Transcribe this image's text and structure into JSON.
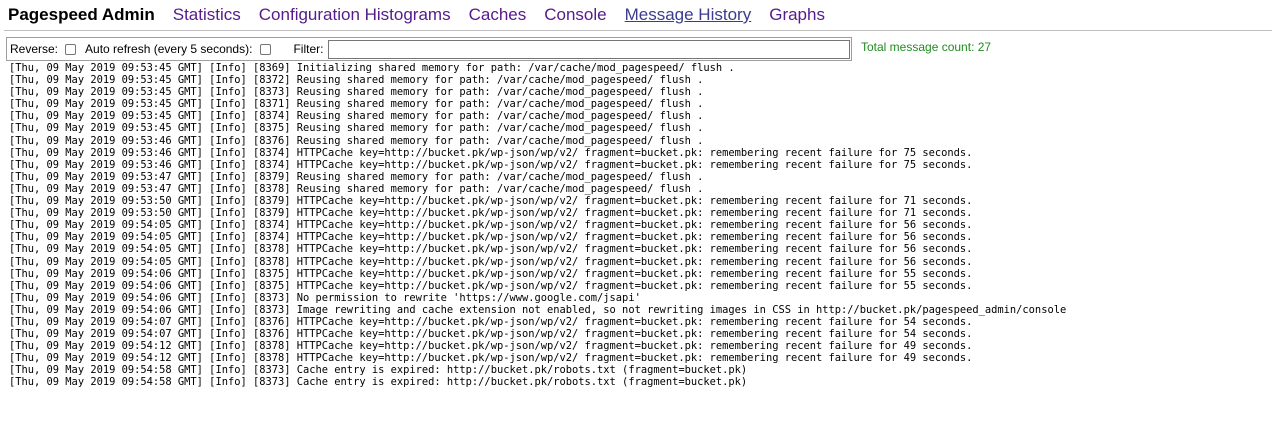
{
  "nav": {
    "brand": "Pagespeed Admin",
    "links": [
      {
        "label": "Statistics"
      },
      {
        "label": "Configuration Histograms"
      },
      {
        "label": "Caches"
      },
      {
        "label": "Console"
      },
      {
        "label": "Message History",
        "active": true
      },
      {
        "label": "Graphs"
      }
    ]
  },
  "controls": {
    "reverse_label": "Reverse:",
    "reverse_checked": false,
    "auto_refresh_label": "Auto refresh (every 5 seconds):",
    "auto_refresh_checked": false,
    "filter_label": "Filter:",
    "filter_value": "",
    "filter_placeholder": ""
  },
  "status": {
    "total_count_text": "Total message count: 27",
    "total_count_color": "#228b22"
  },
  "colors": {
    "link": "#551a8b",
    "active_link": "#3b3b8f"
  },
  "messages": [
    "[Thu, 09 May 2019 09:53:45 GMT] [Info] [8369] Initializing shared memory for path: /var/cache/mod_pagespeed/ flush .",
    "[Thu, 09 May 2019 09:53:45 GMT] [Info] [8372] Reusing shared memory for path: /var/cache/mod_pagespeed/ flush .",
    "[Thu, 09 May 2019 09:53:45 GMT] [Info] [8373] Reusing shared memory for path: /var/cache/mod_pagespeed/ flush .",
    "[Thu, 09 May 2019 09:53:45 GMT] [Info] [8371] Reusing shared memory for path: /var/cache/mod_pagespeed/ flush .",
    "[Thu, 09 May 2019 09:53:45 GMT] [Info] [8374] Reusing shared memory for path: /var/cache/mod_pagespeed/ flush .",
    "[Thu, 09 May 2019 09:53:45 GMT] [Info] [8375] Reusing shared memory for path: /var/cache/mod_pagespeed/ flush .",
    "[Thu, 09 May 2019 09:53:46 GMT] [Info] [8376] Reusing shared memory for path: /var/cache/mod_pagespeed/ flush .",
    "[Thu, 09 May 2019 09:53:46 GMT] [Info] [8374] HTTPCache key=http://bucket.pk/wp-json/wp/v2/ fragment=bucket.pk: remembering recent failure for 75 seconds.",
    "[Thu, 09 May 2019 09:53:46 GMT] [Info] [8374] HTTPCache key=http://bucket.pk/wp-json/wp/v2/ fragment=bucket.pk: remembering recent failure for 75 seconds.",
    "[Thu, 09 May 2019 09:53:47 GMT] [Info] [8379] Reusing shared memory for path: /var/cache/mod_pagespeed/ flush .",
    "[Thu, 09 May 2019 09:53:47 GMT] [Info] [8378] Reusing shared memory for path: /var/cache/mod_pagespeed/ flush .",
    "[Thu, 09 May 2019 09:53:50 GMT] [Info] [8379] HTTPCache key=http://bucket.pk/wp-json/wp/v2/ fragment=bucket.pk: remembering recent failure for 71 seconds.",
    "[Thu, 09 May 2019 09:53:50 GMT] [Info] [8379] HTTPCache key=http://bucket.pk/wp-json/wp/v2/ fragment=bucket.pk: remembering recent failure for 71 seconds.",
    "[Thu, 09 May 2019 09:54:05 GMT] [Info] [8374] HTTPCache key=http://bucket.pk/wp-json/wp/v2/ fragment=bucket.pk: remembering recent failure for 56 seconds.",
    "[Thu, 09 May 2019 09:54:05 GMT] [Info] [8374] HTTPCache key=http://bucket.pk/wp-json/wp/v2/ fragment=bucket.pk: remembering recent failure for 56 seconds.",
    "[Thu, 09 May 2019 09:54:05 GMT] [Info] [8378] HTTPCache key=http://bucket.pk/wp-json/wp/v2/ fragment=bucket.pk: remembering recent failure for 56 seconds.",
    "[Thu, 09 May 2019 09:54:05 GMT] [Info] [8378] HTTPCache key=http://bucket.pk/wp-json/wp/v2/ fragment=bucket.pk: remembering recent failure for 56 seconds.",
    "[Thu, 09 May 2019 09:54:06 GMT] [Info] [8375] HTTPCache key=http://bucket.pk/wp-json/wp/v2/ fragment=bucket.pk: remembering recent failure for 55 seconds.",
    "[Thu, 09 May 2019 09:54:06 GMT] [Info] [8375] HTTPCache key=http://bucket.pk/wp-json/wp/v2/ fragment=bucket.pk: remembering recent failure for 55 seconds.",
    "[Thu, 09 May 2019 09:54:06 GMT] [Info] [8373] No permission to rewrite 'https://www.google.com/jsapi'",
    "[Thu, 09 May 2019 09:54:06 GMT] [Info] [8373] Image rewriting and cache extension not enabled, so not rewriting images in CSS in http://bucket.pk/pagespeed_admin/console",
    "[Thu, 09 May 2019 09:54:07 GMT] [Info] [8376] HTTPCache key=http://bucket.pk/wp-json/wp/v2/ fragment=bucket.pk: remembering recent failure for 54 seconds.",
    "[Thu, 09 May 2019 09:54:07 GMT] [Info] [8376] HTTPCache key=http://bucket.pk/wp-json/wp/v2/ fragment=bucket.pk: remembering recent failure for 54 seconds.",
    "[Thu, 09 May 2019 09:54:12 GMT] [Info] [8378] HTTPCache key=http://bucket.pk/wp-json/wp/v2/ fragment=bucket.pk: remembering recent failure for 49 seconds.",
    "[Thu, 09 May 2019 09:54:12 GMT] [Info] [8378] HTTPCache key=http://bucket.pk/wp-json/wp/v2/ fragment=bucket.pk: remembering recent failure for 49 seconds.",
    "[Thu, 09 May 2019 09:54:58 GMT] [Info] [8373] Cache entry is expired: http://bucket.pk/robots.txt (fragment=bucket.pk)",
    "[Thu, 09 May 2019 09:54:58 GMT] [Info] [8373] Cache entry is expired: http://bucket.pk/robots.txt (fragment=bucket.pk)"
  ]
}
